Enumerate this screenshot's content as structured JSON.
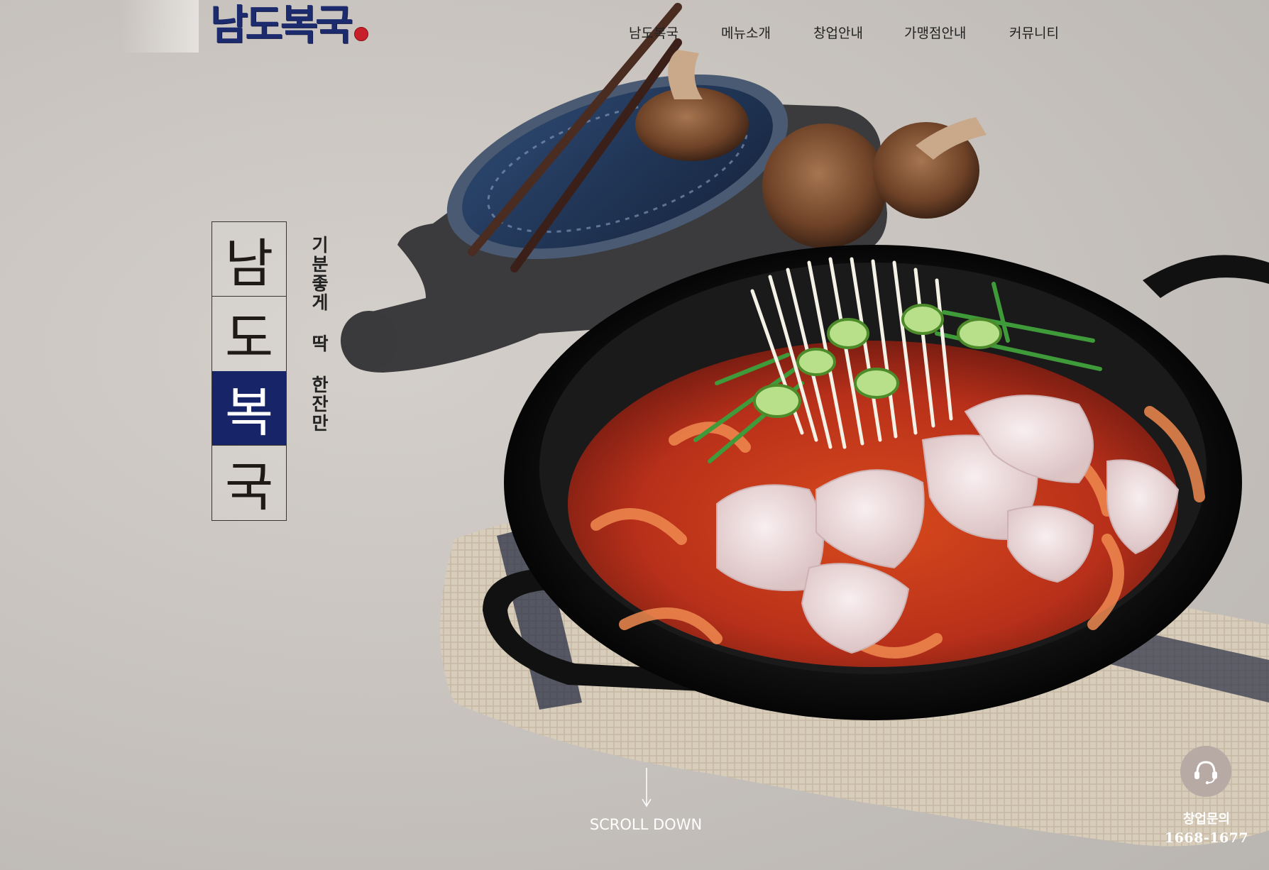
{
  "brand": {
    "logo_text": "남도복국"
  },
  "nav": {
    "items": [
      {
        "label": "남도복국"
      },
      {
        "label": "메뉴소개"
      },
      {
        "label": "창업안내"
      },
      {
        "label": "가맹점안내"
      },
      {
        "label": "커뮤니티"
      }
    ]
  },
  "hero": {
    "title_chars": [
      "남",
      "도",
      "복",
      "국"
    ],
    "tagline": "기분좋게 딱 한잔만",
    "scroll_label": "SCROLL DOWN"
  },
  "contact": {
    "label": "창업문의",
    "phone": "1668-1677",
    "icon": "headset-icon"
  },
  "colors": {
    "brand_navy": "#182468",
    "logo_navy": "#1c2a6e",
    "seal_red": "#c8202a",
    "background": "#c9c4bf",
    "contact_button": "#b7aaa4"
  }
}
